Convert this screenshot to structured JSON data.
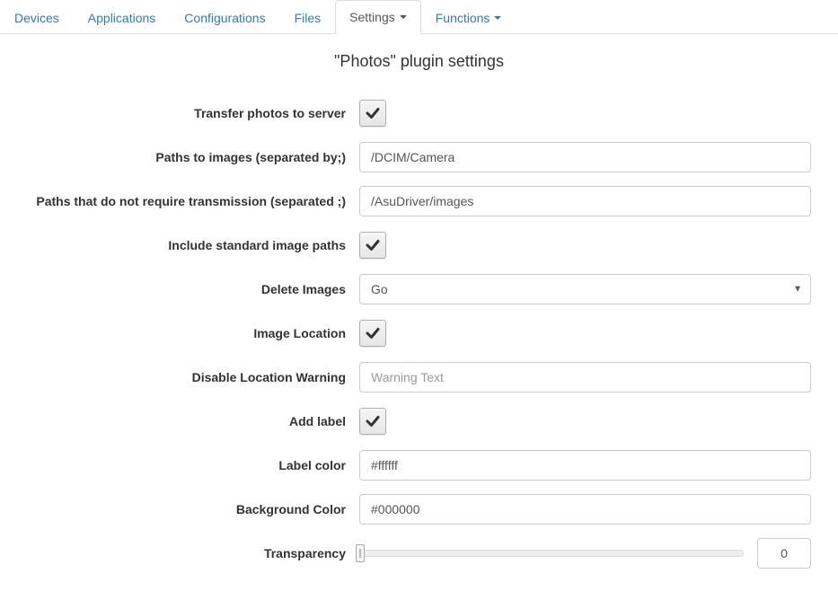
{
  "tabs": {
    "devices": "Devices",
    "applications": "Applications",
    "configurations": "Configurations",
    "files": "Files",
    "settings": "Settings",
    "functions": "Functions"
  },
  "page": {
    "title": "\"Photos\" plugin settings"
  },
  "form": {
    "transfer_label": "Transfer photos to server",
    "transfer_checked": true,
    "paths_images_label": "Paths to images (separated by;)",
    "paths_images_value": "/DCIM/Camera",
    "paths_exclude_label": "Paths that do not require transmission (separated ;)",
    "paths_exclude_value": "/AsuDriver/images",
    "include_std_label": "Include standard image paths",
    "include_std_checked": true,
    "delete_images_label": "Delete Images",
    "delete_images_value": "Go",
    "image_location_label": "Image Location",
    "image_location_checked": true,
    "disable_warning_label": "Disable Location Warning",
    "disable_warning_placeholder": "Warning Text",
    "add_label_label": "Add label",
    "add_label_checked": true,
    "label_color_label": "Label color",
    "label_color_value": "#ffffff",
    "bg_color_label": "Background Color",
    "bg_color_value": "#000000",
    "transparency_label": "Transparency",
    "transparency_value": "0"
  }
}
